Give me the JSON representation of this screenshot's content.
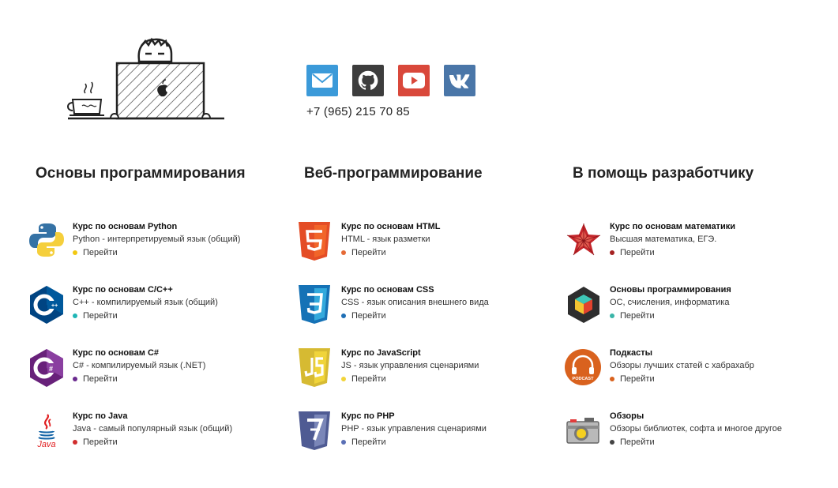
{
  "contacts": {
    "phone": "+7 (965) 215 70 85",
    "social": [
      {
        "icon": "mail-icon",
        "color": "#3b9ad9"
      },
      {
        "icon": "github-icon",
        "color": "#3d3d3d"
      },
      {
        "icon": "youtube-icon",
        "color": "#d9483b"
      },
      {
        "icon": "vk-icon",
        "color": "#4a76a8"
      }
    ]
  },
  "columns": [
    {
      "title": "Основы программирования",
      "items": [
        {
          "name": "Курс по основам Python",
          "desc": "Python - интерпретируемый язык (общий)",
          "link": "Перейти",
          "icon": "python-logo-icon",
          "dot": "#f2c811"
        },
        {
          "name": "Курс по основам C/C++",
          "desc": "C++ - компилируемый язык (общий)",
          "link": "Перейти",
          "icon": "cpp-logo-icon",
          "dot": "#1fb5b5"
        },
        {
          "name": "Курс по основам C#",
          "desc": "C# - компилируемый язык (.NET)",
          "link": "Перейти",
          "icon": "csharp-logo-icon",
          "dot": "#6a2a8f"
        },
        {
          "name": "Курс по Java",
          "desc": "Java - самый популярный язык (общий)",
          "link": "Перейти",
          "icon": "java-logo-icon",
          "dot": "#d12d2d"
        }
      ]
    },
    {
      "title": "Веб-программирование",
      "items": [
        {
          "name": "Курс по основам HTML",
          "desc": "HTML - язык разметки",
          "link": "Перейти",
          "icon": "html5-logo-icon",
          "dot": "#e56a36"
        },
        {
          "name": "Курс по основам CSS",
          "desc": "CSS - язык описания внешнего вида",
          "link": "Перейти",
          "icon": "css3-logo-icon",
          "dot": "#1f6fb5"
        },
        {
          "name": "Курс по JavaScript",
          "desc": "JS - язык управления сценариями",
          "link": "Перейти",
          "icon": "js-logo-icon",
          "dot": "#f2d43a"
        },
        {
          "name": "Курс по PHP",
          "desc": "PHP - язык управления сценариями",
          "link": "Перейти",
          "icon": "php-logo-icon",
          "dot": "#5a6fb5"
        }
      ]
    },
    {
      "title": "В помощь разработчику",
      "items": [
        {
          "name": "Курс по основам математики",
          "desc": "Высшая математика, ЕГЭ.",
          "link": "Перейти",
          "icon": "wolfram-logo-icon",
          "dot": "#a52222"
        },
        {
          "name": "Основы программирования",
          "desc": "ОС, счисления, информатика",
          "link": "Перейти",
          "icon": "cube-logo-icon",
          "dot": "#3ab5a8"
        },
        {
          "name": "Подкасты",
          "desc": "Обзоры лучших статей с хабрахабр",
          "link": "Перейти",
          "icon": "podcast-logo-icon",
          "dot": "#d9621e"
        },
        {
          "name": "Обзоры",
          "desc": "Обзоры библиотек, софта и многое другое",
          "link": "Перейти",
          "icon": "camera-logo-icon",
          "dot": "#444444"
        }
      ]
    }
  ],
  "illustration": {
    "icon": "developer-at-laptop-illustration"
  }
}
